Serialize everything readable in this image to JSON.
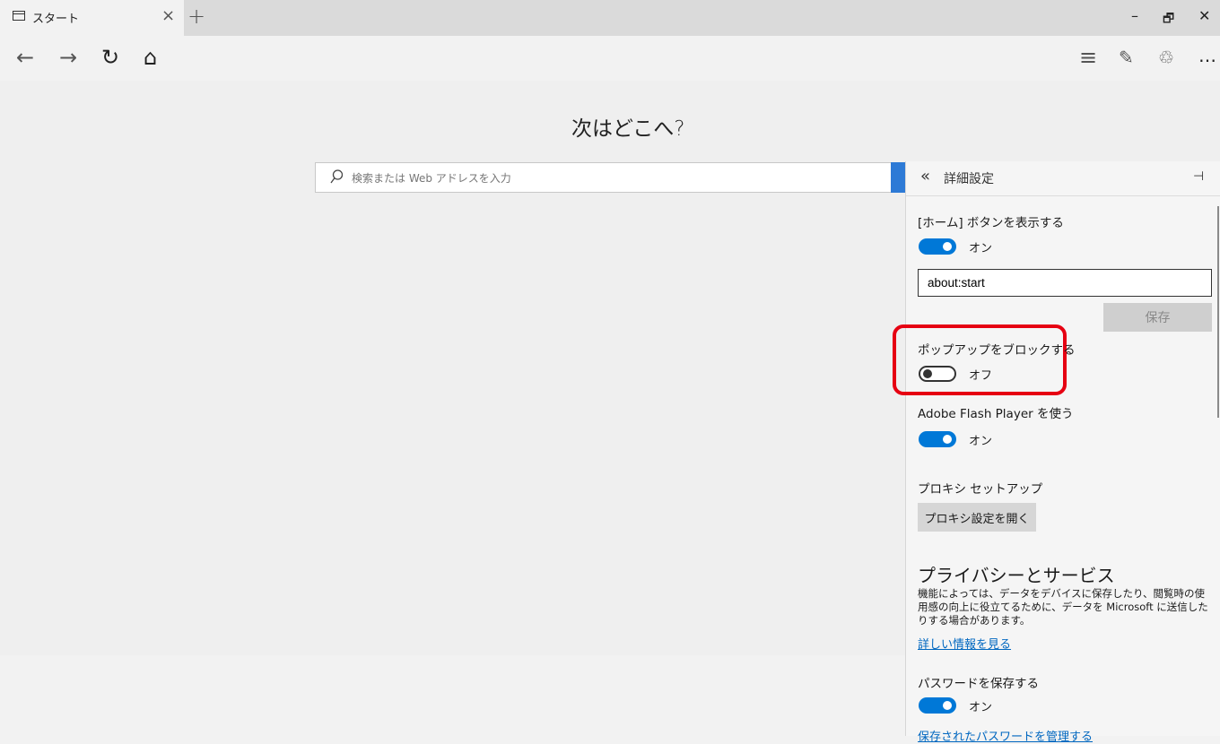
{
  "titlebar": {
    "tab_title": "スタート",
    "close_glyph": "×",
    "new_tab_glyph": "+",
    "minimize_glyph": "–",
    "restore_glyph": "🗗",
    "close_window_glyph": "✕"
  },
  "nav": {
    "back_glyph": "←",
    "forward_glyph": "→",
    "refresh_glyph": "↻",
    "home_glyph": "⌂",
    "hub_glyph": "≡",
    "note_glyph": "✎",
    "share_glyph": "♲",
    "more_glyph": "…"
  },
  "start": {
    "headline": "次はどこへ?",
    "search_placeholder": "検索または Web アドレスを入力"
  },
  "panel": {
    "back_glyph": "«",
    "title": "詳細設定",
    "pin_glyph": "⊣",
    "home_button_label": "[ホーム] ボタンを表示する",
    "home_button_state": "オン",
    "home_url": "about:start",
    "save_label": "保存",
    "popup_label": "ポップアップをブロックする",
    "popup_state": "オフ",
    "flash_label": "Adobe Flash Player を使う",
    "flash_state": "オン",
    "proxy_label": "プロキシ セットアップ",
    "proxy_button": "プロキシ設定を開く",
    "privacy_title": "プライバシーとサービス",
    "privacy_desc": "機能によっては、データをデバイスに保存したり、閲覧時の使用感の向上に役立てるために、データを Microsoft に送信したりする場合があります。",
    "privacy_link": "詳しい情報を見る",
    "password_label": "パスワードを保存する",
    "password_state": "オン",
    "manage_passwords_link": "保存されたパスワードを管理する"
  },
  "colors": {
    "accent": "#0078d7",
    "highlight": "#e60012"
  }
}
